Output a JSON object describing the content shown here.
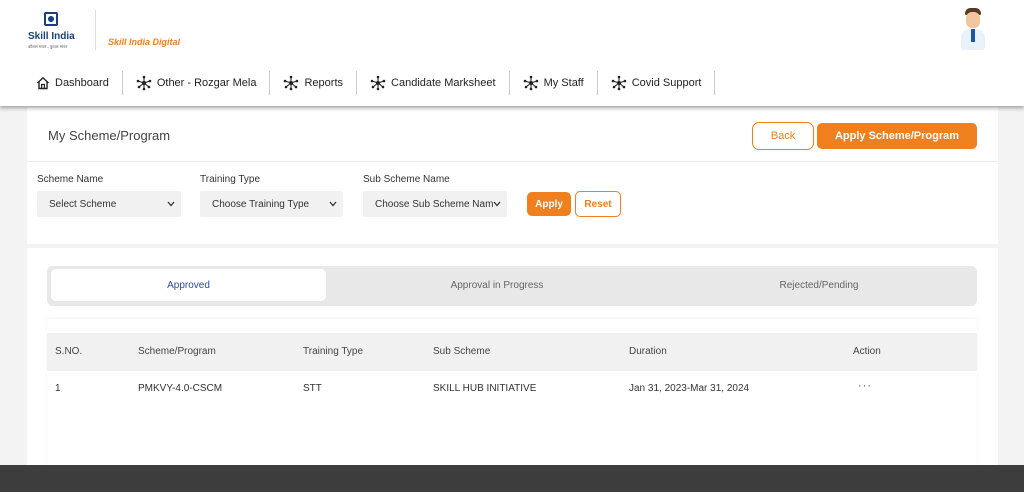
{
  "header": {
    "logo_text": "Skill India",
    "logo_tagline": "कौशल भारत - कुशल भारत",
    "brand": "Skill India Digital"
  },
  "nav": [
    {
      "label": "Dashboard",
      "icon": "home-icon"
    },
    {
      "label": "Other - Rozgar Mela",
      "icon": "network-icon"
    },
    {
      "label": "Reports",
      "icon": "network-icon"
    },
    {
      "label": "Candidate Marksheet",
      "icon": "network-icon"
    },
    {
      "label": "My Staff",
      "icon": "network-icon"
    },
    {
      "label": "Covid Support",
      "icon": "network-icon"
    }
  ],
  "page": {
    "title": "My Scheme/Program",
    "back_label": "Back",
    "apply_scheme_label": "Apply Scheme/Program"
  },
  "filters": {
    "scheme_name": {
      "label": "Scheme Name",
      "value": "Select Scheme"
    },
    "training_type": {
      "label": "Training Type",
      "value": "Choose Training Type"
    },
    "sub_scheme_name": {
      "label": "Sub Scheme Name",
      "value": "Choose Sub Scheme Nam"
    },
    "apply_label": "Apply",
    "reset_label": "Reset"
  },
  "tabs": [
    {
      "label": "Approved",
      "active": true
    },
    {
      "label": "Approval in Progress",
      "active": false
    },
    {
      "label": "Rejected/Pending",
      "active": false
    }
  ],
  "table": {
    "columns": [
      "S.NO.",
      "Scheme/Program",
      "Training Type",
      "Sub Scheme",
      "Duration",
      "Action"
    ],
    "rows": [
      {
        "sno": "1",
        "scheme": "PMKVY-4.0-CSCM",
        "training_type": "STT",
        "sub_scheme": "SKILL HUB INITIATIVE",
        "duration": "Jan 31, 2023-Mar 31, 2024",
        "action": "···"
      }
    ]
  },
  "colors": {
    "accent": "#f07f1e",
    "active_tab_text": "#2d4a9a",
    "footer": "#3d3d3d"
  }
}
